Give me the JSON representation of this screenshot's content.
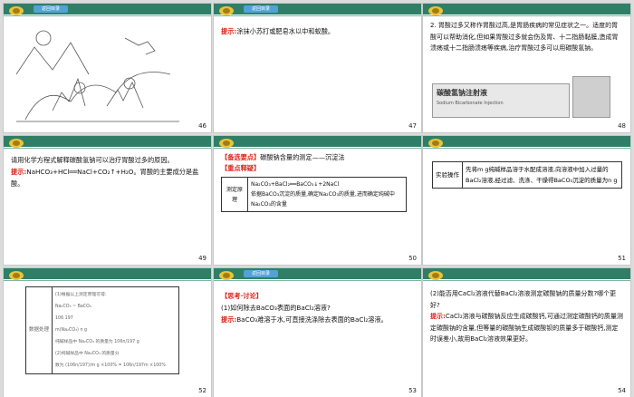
{
  "back_button_label": "返回目录",
  "slides": [
    {
      "number": "46"
    },
    {
      "number": "47",
      "tip_label": "提示:",
      "tip_text": "涂抹小苏打或肥皂水以中和蚁酸。"
    },
    {
      "number": "48",
      "text": "2. 胃酸过多又称作胃酸过高,是胃肠疾病的常见症状之一。适度的胃酸可以帮助消化,但如果胃酸过多就会伤及胃、十二指肠黏膜,造成胃溃疡或十二指肠溃疡等疾病,治疗胃酸过多可以用碳酸氢钠。",
      "photo_title": "碳酸氢钠注射液",
      "photo_sub": "Sodium Bicarbonate Injection"
    },
    {
      "number": "49",
      "question": "请用化学方程式解释碳酸氢钠可以治疗胃酸过多的原因。",
      "tip_label": "提示:",
      "tip_text": "NaHCO₃+HCl══NaCl+CO₂↑+H₂O。胃酸的主要成分是盐酸。"
    },
    {
      "number": "50",
      "key_point": "【备选要点】",
      "key_text": "碳酸钠含量的测定——沉淀法",
      "focus": "【重点释疑】",
      "table_label": "测定原理",
      "table_eq": "Na₂CO₃+BaCl₂══BaCO₃↓+2NaCl",
      "table_text": "依据BaCO₃沉淀的质量,确定Na₂CO₃的质量,进而确定纯碱中Na₂CO₃的含量"
    },
    {
      "number": "51",
      "table_label": "实验操作",
      "table_text": "先将m g纯碱样品溶于水配成溶液,向溶液中加入过量的BaCl₂溶液,经过滤、洗涤、干燥得BaCO₃沉淀的质量为n g"
    },
    {
      "number": "52",
      "table_label": "数据处理",
      "lines": [
        "(1)根据以上测定原理可得:",
        "Na₂CO₃        ~        BaCO₃",
        "106                      197",
        "m(Na₂CO₃)               n g",
        "纯碱样品中 Na₂CO₃ 的质量为 106n/197 g",
        "(2)纯碱样品中 Na₂CO₃ 的质量分",
        "数为 (106n/197)/m g ×100% = 106n/197m ×100%"
      ]
    },
    {
      "number": "53",
      "think": "【思考·讨论】",
      "question": "(1)如何除去BaCO₃表面的BaCl₂溶液?",
      "tip_label": "提示:",
      "tip_text": "BaCO₃难溶于水,可直接洗涤除去表面的BaCl₂溶液。"
    },
    {
      "number": "54",
      "question": "(2)能否用CaCl₂溶液代替BaCl₂溶液测定碳酸钠的质量分数?哪个更好?",
      "tip_label": "提示:",
      "tip_text": "CaCl₂溶液与碳酸钠反应生成碳酸钙,可通过测定碳酸钙的质量测定碳酸钠的含量,但等量的碳酸钠生成碳酸钡的质量多于碳酸钙,测定时误差小,故用BaCl₂溶液效果更好。"
    }
  ],
  "colors": {
    "bar": "#2f7f67",
    "button": "#4fa3d9",
    "accent": "#d9241c"
  }
}
